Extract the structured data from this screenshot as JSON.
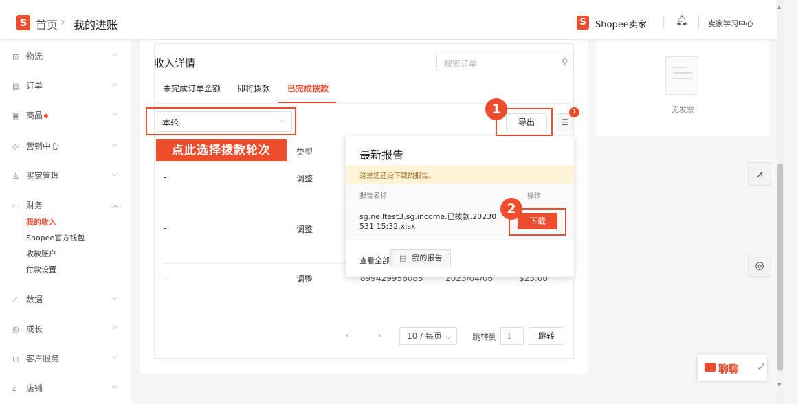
{
  "header": {
    "logo_letter": "S",
    "breadcrumb_home": "首页",
    "breadcrumb_sep": "›",
    "breadcrumb_current": "我的进账",
    "seller_label": "Shopee卖家",
    "bell_icon": "bell-icon",
    "learn_center": "卖家学习中心"
  },
  "sidebar": {
    "items": [
      {
        "icon": "truck-icon",
        "glyph": "⊡",
        "label": "物流"
      },
      {
        "icon": "order-icon",
        "glyph": "▤",
        "label": "订单"
      },
      {
        "icon": "product-icon",
        "glyph": "▣",
        "label": "商品"
      },
      {
        "icon": "tag-icon",
        "glyph": "◇",
        "label": "营销中心"
      },
      {
        "icon": "user-icon",
        "glyph": "♙",
        "label": "买家管理"
      },
      {
        "icon": "wallet-icon",
        "glyph": "▭",
        "label": "财务"
      },
      {
        "icon": "chart-icon",
        "glyph": "⟋",
        "label": "数据"
      },
      {
        "icon": "growth-icon",
        "glyph": "◎",
        "label": "成长"
      },
      {
        "icon": "service-icon",
        "glyph": "⊟",
        "label": "客户服务"
      },
      {
        "icon": "shop-icon",
        "glyph": "⌂",
        "label": "店铺"
      }
    ],
    "finance_sub": [
      "我的收入",
      "Shopee官方钱包",
      "收款账户",
      "付款设置"
    ]
  },
  "main": {
    "title": "收入详情",
    "search_placeholder": "搜索订单",
    "tabs": [
      "未完成订单金额",
      "即将拨款",
      "已完成拨款"
    ],
    "active_tab": 2,
    "select_value": "本轮",
    "annotation": "点此选择拨款轮次",
    "column_type": "类型",
    "rows": [
      {
        "c1": "-",
        "type": "调整"
      },
      {
        "c1": "-",
        "type": "调整"
      },
      {
        "c1": "-",
        "type": "调整",
        "order_partial": "899429956085",
        "date_partial": "2023/04/06",
        "amount_partial": "$23.00"
      }
    ],
    "export_label": "导出",
    "step1": "1",
    "step2": "2",
    "menu_count": "1"
  },
  "popup": {
    "title": "最新报告",
    "notice": "这是您还没下载的报告。",
    "col_name": "报告名称",
    "col_op": "操作",
    "file_name": "sg.neiltest3.sg.income.已拨款.20230531 15:32.xlsx",
    "download_label": "下载",
    "view_all": "查看全部",
    "my_reports": "我的报告"
  },
  "pagination": {
    "prev": "‹",
    "next": "›",
    "page_size": "10 / 每页",
    "goto_label": "跳转到",
    "goto_value": "1",
    "jump_label": "跳转"
  },
  "right_panel": {
    "empty_text": "无发票"
  },
  "chat": {
    "label": "聊聊"
  },
  "colors": {
    "accent": "#ee4d2d"
  }
}
